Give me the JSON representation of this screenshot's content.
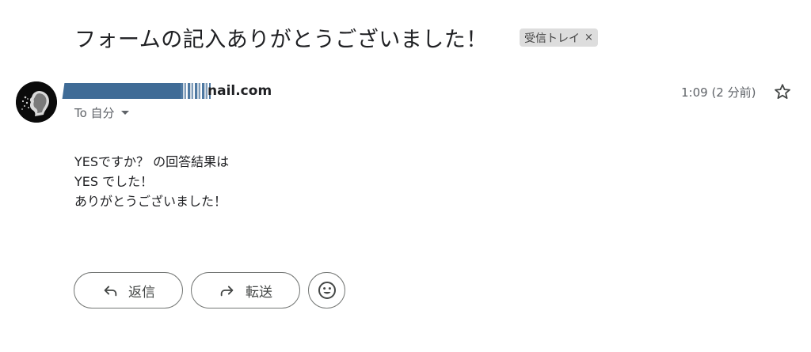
{
  "email": {
    "subject": "フォームの記入ありがとうございました！",
    "label_chip": {
      "text": "受信トレイ",
      "remove_glyph": "×"
    },
    "sender": {
      "visible_domain": "nail.com"
    },
    "recipient": "To 自分",
    "time": "1:09 (2 分前)",
    "body_lines": [
      "YESですか？ の回答結果は",
      "YES でした！",
      "ありがとうございました！"
    ]
  },
  "actions": {
    "reply_label": "返信",
    "forward_label": "転送"
  },
  "icons": {
    "star": "star-outline-icon",
    "reply": "reply-arrow-icon",
    "forward": "forward-arrow-icon",
    "emoji": "emoji-smile-icon",
    "caret": "caret-down-icon"
  },
  "colors": {
    "text": "#202124",
    "secondary": "#5f6368",
    "chip_bg": "#dddddd",
    "redaction": "#3f6b96"
  }
}
